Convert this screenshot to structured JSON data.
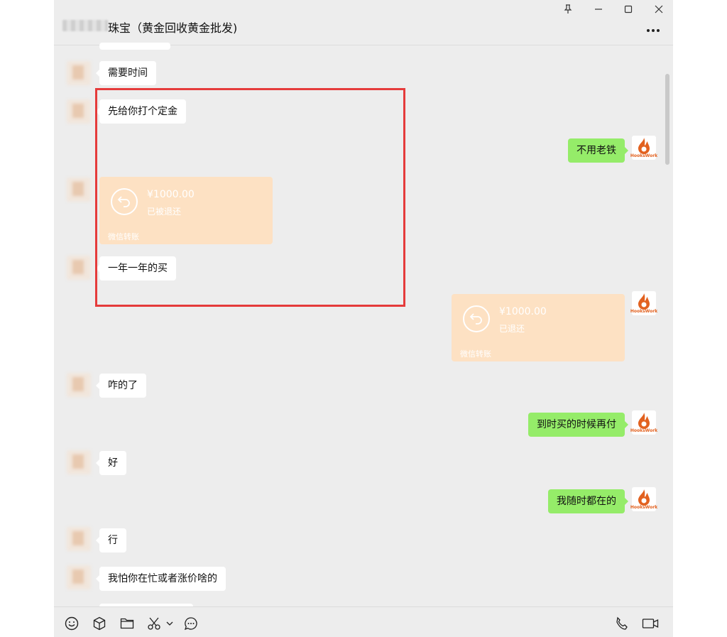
{
  "window": {
    "title": "珠宝（黄金回收黄金批发)",
    "controls": [
      "pin-icon",
      "minimize-icon",
      "maximize-icon",
      "close-icon"
    ]
  },
  "messages": {
    "m1": "需要时间",
    "m2": "先给你打个定金",
    "m3": "不用老铁",
    "m4": {
      "amount": "¥1000.00",
      "status": "已被退还",
      "label": "微信转账"
    },
    "m5": "一年一年的买",
    "m6": {
      "amount": "¥1000.00",
      "status": "已退还",
      "label": "微信转账"
    },
    "m7": "咋的了",
    "m8": "到时买的时候再付",
    "m9": "好",
    "m10": "我随时都在的",
    "m11": "行",
    "m12": "我怕你在忙或者涨价啥的"
  },
  "self_avatar": {
    "text": "HooksWork",
    "color": "#e2611f"
  },
  "colors": {
    "highlight": "#e53b3b",
    "sent_bubble": "#95ec69",
    "transfer_card": "#fde1c3"
  },
  "toolbar": {
    "left": [
      "emoji-icon",
      "package-icon",
      "folder-icon",
      "scissors-icon",
      "chat-history-icon"
    ],
    "right": [
      "phone-icon",
      "video-icon"
    ]
  }
}
